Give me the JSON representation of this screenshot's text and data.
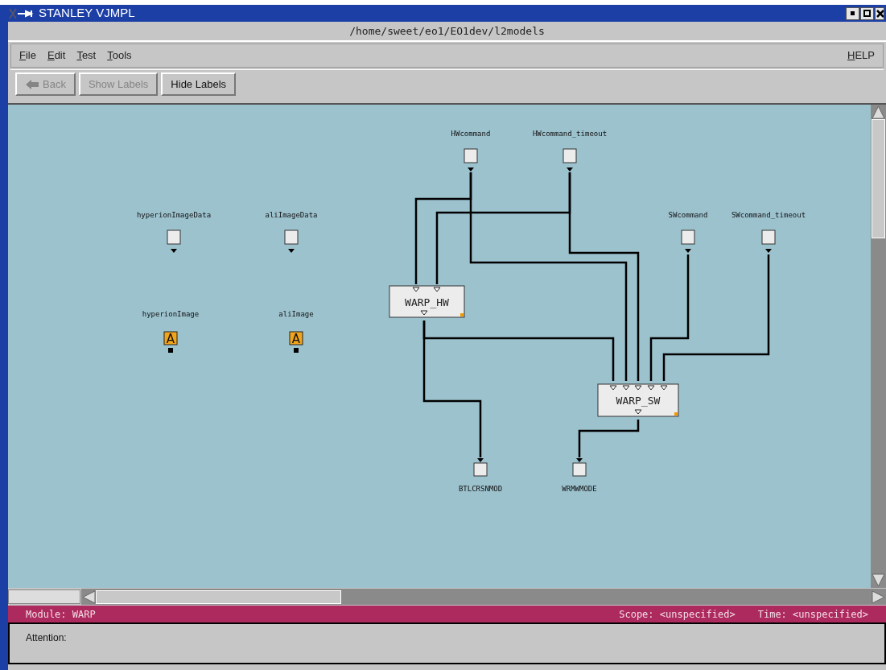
{
  "window": {
    "title": "STANLEY VJMPL",
    "path": "/home/sweet/eo1/EO1dev/l2models"
  },
  "menu": [
    {
      "label": "File"
    },
    {
      "label": "Edit"
    },
    {
      "label": "Test"
    },
    {
      "label": "Tools"
    }
  ],
  "help_menu": {
    "label": "HELP"
  },
  "toolbar": [
    {
      "kind": "back",
      "label": "Back",
      "disabled": true
    },
    {
      "kind": "text",
      "label": "Show Labels",
      "disabled": true
    },
    {
      "kind": "text",
      "label": "Hide Labels",
      "disabled": false
    }
  ],
  "diagram": {
    "nodes": [
      {
        "kind": "input",
        "label": "HWcommand"
      },
      {
        "kind": "input",
        "label": "HWcommand_timeout"
      },
      {
        "kind": "input",
        "label": "hyperionImageData"
      },
      {
        "kind": "input",
        "label": "aliImageData"
      },
      {
        "kind": "input",
        "label": "SWcommand"
      },
      {
        "kind": "input",
        "label": "SWcommand_timeout"
      },
      {
        "kind": "attribute",
        "label": "hyperionImage",
        "glyph": "A"
      },
      {
        "kind": "attribute",
        "label": "aliImage",
        "glyph": "A"
      },
      {
        "kind": "module",
        "label": "WARP_HW"
      },
      {
        "kind": "module",
        "label": "WARP_SW"
      },
      {
        "kind": "output",
        "label": "BTLCRSNMOD"
      },
      {
        "kind": "output",
        "label": "WRMWMODE"
      }
    ]
  },
  "status_bar": {
    "module": "Module: WARP",
    "scope": "Scope: <unspecified>",
    "time": "Time: <unspecified>"
  },
  "message_panel": {
    "label": "Attention:"
  }
}
